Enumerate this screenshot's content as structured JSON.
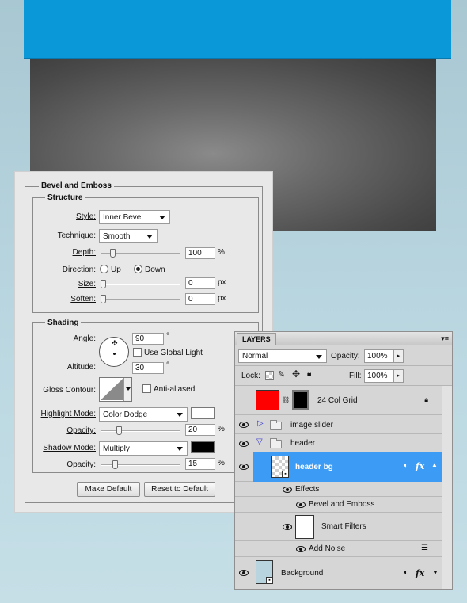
{
  "dialog": {
    "title": "Bevel and Emboss",
    "structure": {
      "title": "Structure",
      "style_label": "Style:",
      "style_value": "Inner Bevel",
      "technique_label": "Technique:",
      "technique_value": "Smooth",
      "depth_label": "Depth:",
      "depth_value": "100",
      "depth_unit": "%",
      "direction_label": "Direction:",
      "direction_up": "Up",
      "direction_down": "Down",
      "direction_selected": "Down",
      "size_label": "Size:",
      "size_value": "0",
      "size_unit": "px",
      "soften_label": "Soften:",
      "soften_value": "0",
      "soften_unit": "px"
    },
    "shading": {
      "title": "Shading",
      "angle_label": "Angle:",
      "angle_value": "90",
      "angle_unit": "°",
      "global_light_label": "Use Global Light",
      "altitude_label": "Altitude:",
      "altitude_value": "30",
      "altitude_unit": "°",
      "gloss_label": "Gloss Contour:",
      "anti_aliased_label": "Anti-aliased",
      "highlight_mode_label": "Highlight Mode:",
      "highlight_mode_value": "Color Dodge",
      "highlight_color": "#ffffff",
      "highlight_opacity_label": "Opacity:",
      "highlight_opacity_value": "20",
      "highlight_opacity_unit": "%",
      "shadow_mode_label": "Shadow Mode:",
      "shadow_mode_value": "Multiply",
      "shadow_color": "#000000",
      "shadow_opacity_label": "Opacity:",
      "shadow_opacity_value": "15",
      "shadow_opacity_unit": "%"
    },
    "make_default_label": "Make Default",
    "reset_default_label": "Reset to Default"
  },
  "layers": {
    "tab_label": "LAYERS",
    "menu_icon": "panel-menu-icon",
    "blend_mode": "Normal",
    "opacity_label": "Opacity:",
    "opacity_value": "100%",
    "lock_label": "Lock:",
    "fill_label": "Fill:",
    "fill_value": "100%",
    "rows": {
      "grid": "24 Col Grid",
      "image_slider": "image slider",
      "header": "header",
      "header_bg": "header bg",
      "effects": "Effects",
      "bevel": "Bevel and Emboss",
      "smart_filters": "Smart Filters",
      "add_noise": "Add Noise",
      "background": "Background"
    },
    "fx_label": "fx"
  },
  "colors": {
    "canvas_blue": "#0a98d8",
    "selection": "#3b9bf5",
    "grid_swatch": "#ff0000"
  }
}
